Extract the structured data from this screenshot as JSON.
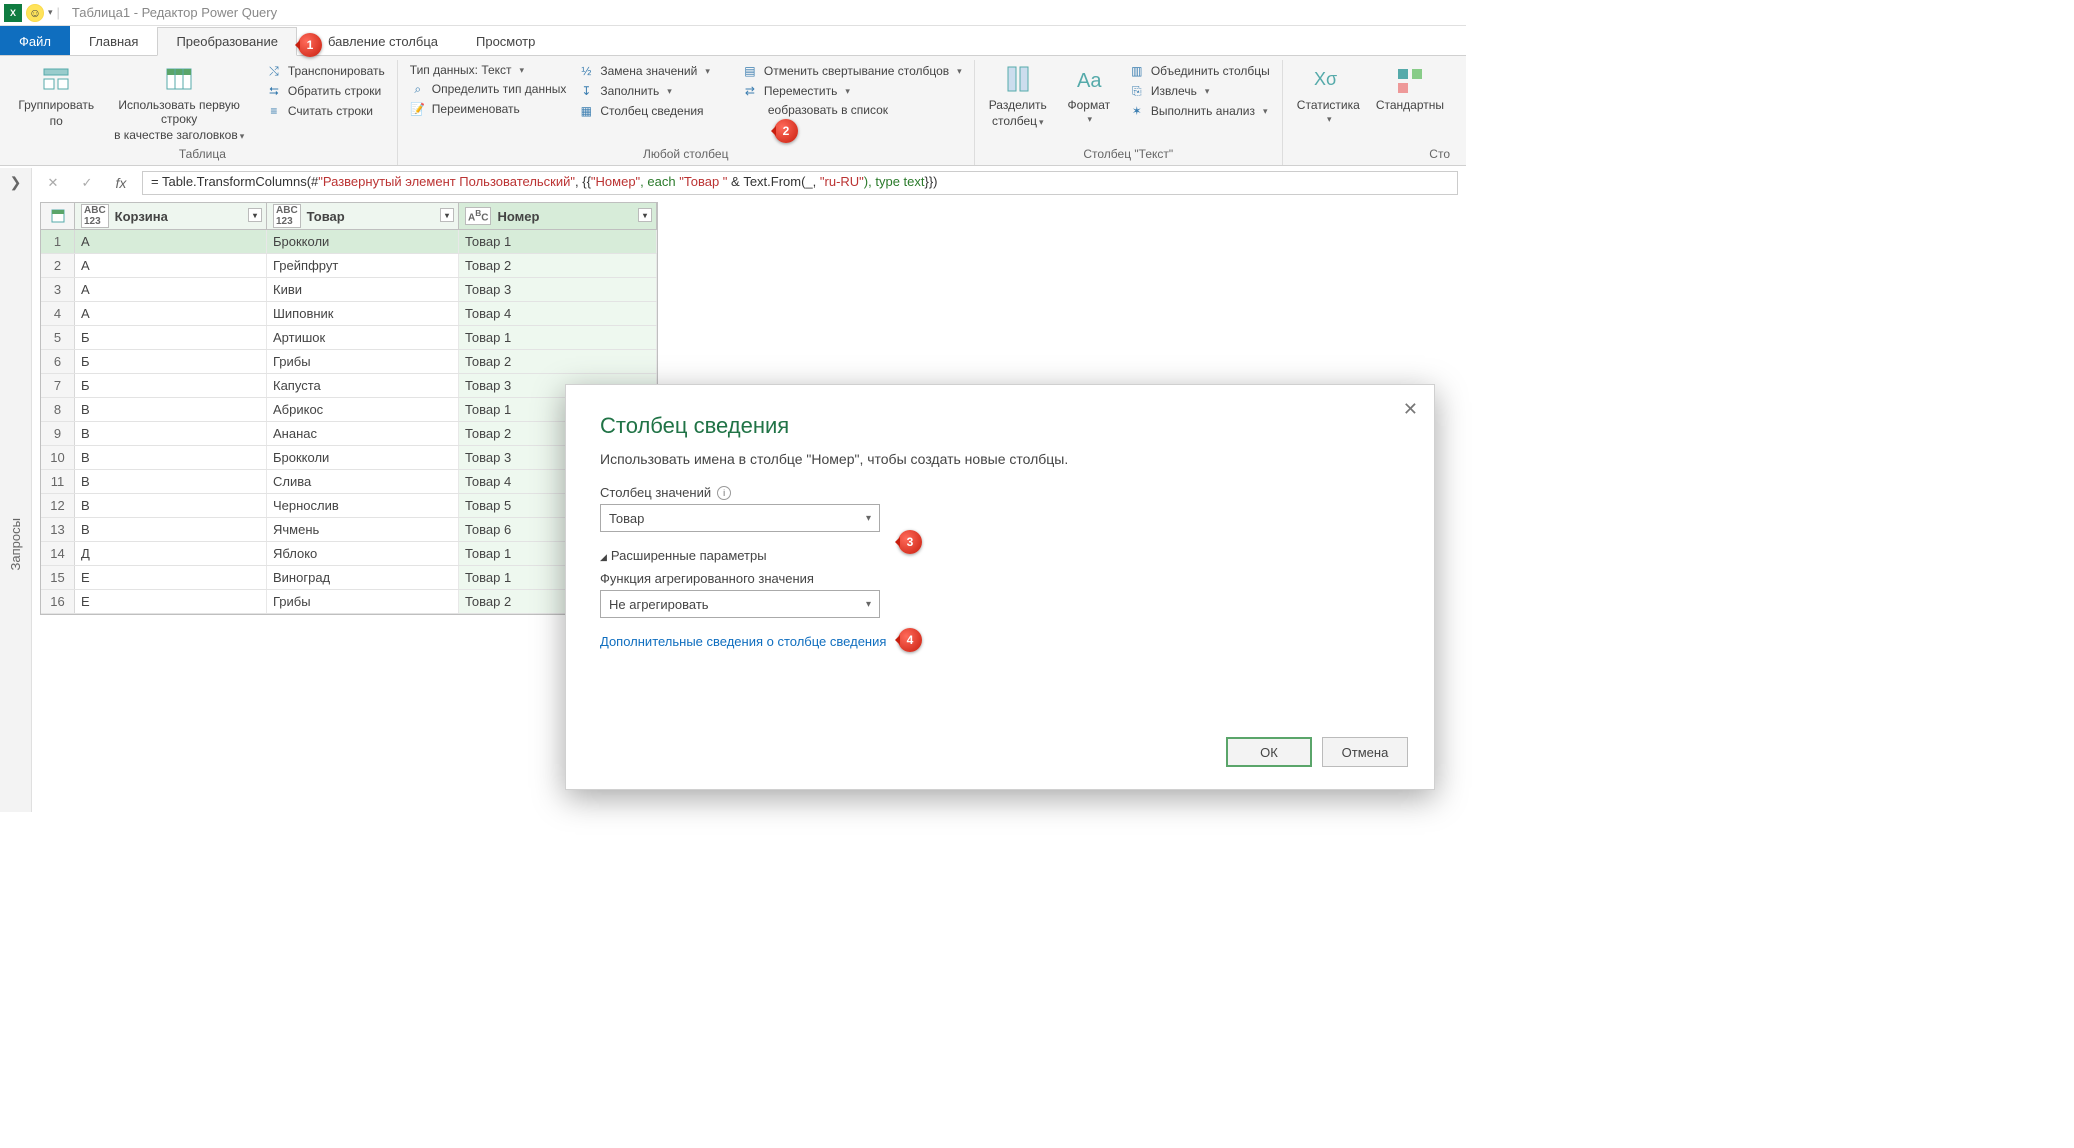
{
  "title": "Таблица1 - Редактор Power Query",
  "tabs": {
    "file": "Файл",
    "home": "Главная",
    "transform": "Преобразование",
    "addcol": "бавление столбца",
    "view": "Просмотр"
  },
  "ribbon": {
    "table": {
      "group_by_l1": "Группировать",
      "group_by_l2": "по",
      "headers_l1": "Использовать первую строку",
      "headers_l2": "в качестве заголовков",
      "transpose": "Транспонировать",
      "reverse": "Обратить строки",
      "count": "Считать строки",
      "label": "Таблица"
    },
    "anycol": {
      "datatype": "Тип данных: Текст",
      "detect": "Определить тип данных",
      "rename": "Переименовать",
      "replace": "Замена значений",
      "fill": "Заполнить",
      "pivot": "Столбец сведения",
      "unpivot": "Отменить свертывание столбцов",
      "move": "Переместить",
      "tolist": "еобразовать в список",
      "label": "Любой столбец"
    },
    "textcol": {
      "split_l1": "Разделить",
      "split_l2": "столбец",
      "format": "Формат",
      "merge": "Объединить столбцы",
      "extract": "Извлечь",
      "analyze": "Выполнить анализ",
      "label": "Столбец \"Текст\""
    },
    "number": {
      "stats": "Статистика",
      "std": "Стандартны",
      "label": "Сто"
    }
  },
  "queries_label": "Запросы",
  "formula_prefix": "= Table.TransformColumns(#",
  "formula_str1": "\"Развернутый элемент Пользовательский\"",
  "formula_mid": ", {{",
  "formula_str2": "\"Номер\"",
  "formula_each": ", each ",
  "formula_str3": "\"Товар \"",
  "formula_amp": " & Text.From(_, ",
  "formula_str4": "\"ru-RU\"",
  "formula_type": "), type text",
  "formula_end": "}})",
  "columns": {
    "c1": "Корзина",
    "c2": "Товар",
    "c3": "Номер"
  },
  "rows": [
    {
      "n": 1,
      "c1": "А",
      "c2": "Брокколи",
      "c3": "Товар 1"
    },
    {
      "n": 2,
      "c1": "А",
      "c2": "Грейпфрут",
      "c3": "Товар 2"
    },
    {
      "n": 3,
      "c1": "А",
      "c2": "Киви",
      "c3": "Товар 3"
    },
    {
      "n": 4,
      "c1": "А",
      "c2": "Шиповник",
      "c3": "Товар 4"
    },
    {
      "n": 5,
      "c1": "Б",
      "c2": "Артишок",
      "c3": "Товар 1"
    },
    {
      "n": 6,
      "c1": "Б",
      "c2": "Грибы",
      "c3": "Товар 2"
    },
    {
      "n": 7,
      "c1": "Б",
      "c2": "Капуста",
      "c3": "Товар 3"
    },
    {
      "n": 8,
      "c1": "В",
      "c2": "Абрикос",
      "c3": "Товар 1"
    },
    {
      "n": 9,
      "c1": "В",
      "c2": "Ананас",
      "c3": "Товар 2"
    },
    {
      "n": 10,
      "c1": "В",
      "c2": "Брокколи",
      "c3": "Товар 3"
    },
    {
      "n": 11,
      "c1": "В",
      "c2": "Слива",
      "c3": "Товар 4"
    },
    {
      "n": 12,
      "c1": "В",
      "c2": "Чернослив",
      "c3": "Товар 5"
    },
    {
      "n": 13,
      "c1": "В",
      "c2": "Ячмень",
      "c3": "Товар 6"
    },
    {
      "n": 14,
      "c1": "Д",
      "c2": "Яблоко",
      "c3": "Товар 1"
    },
    {
      "n": 15,
      "c1": "Е",
      "c2": "Виноград",
      "c3": "Товар 1"
    },
    {
      "n": 16,
      "c1": "Е",
      "c2": "Грибы",
      "c3": "Товар 2"
    }
  ],
  "dialog": {
    "title": "Столбец сведения",
    "desc": "Использовать имена в столбце \"Номер\", чтобы создать новые столбцы.",
    "values_label": "Столбец значений",
    "values_value": "Товар",
    "advanced": "Расширенные параметры",
    "agg_label": "Функция агрегированного значения",
    "agg_value": "Не агрегировать",
    "link": "Дополнительные сведения о столбце сведения",
    "ok": "ОК",
    "cancel": "Отмена"
  },
  "callouts": {
    "c1": "1",
    "c2": "2",
    "c3": "3",
    "c4": "4"
  }
}
